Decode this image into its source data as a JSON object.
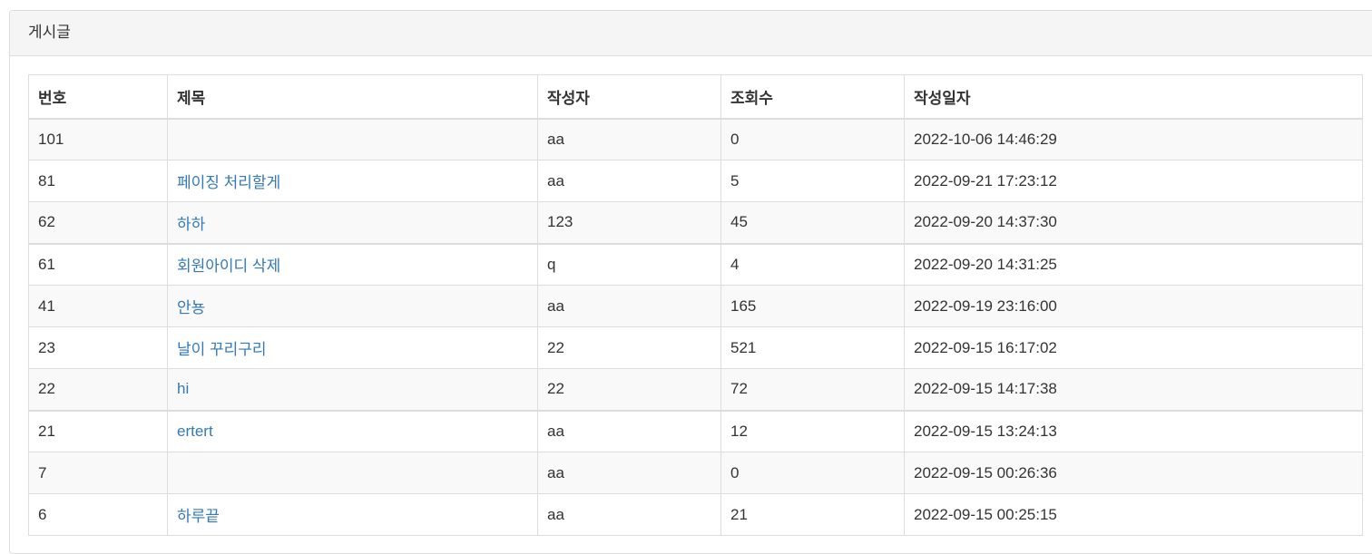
{
  "panel": {
    "heading": "게시글"
  },
  "table": {
    "headers": {
      "no": "번호",
      "title": "제목",
      "author": "작성자",
      "views": "조회수",
      "date": "작성일자"
    },
    "rows": [
      {
        "no": "101",
        "title": "",
        "author": "aa",
        "views": "0",
        "date": "2022-10-06 14:46:29"
      },
      {
        "no": "81",
        "title": "페이징 처리할게",
        "author": "aa",
        "views": "5",
        "date": "2022-09-21 17:23:12"
      },
      {
        "no": "62",
        "title": "하하",
        "author": "123",
        "views": "45",
        "date": "2022-09-20 14:37:30"
      },
      {
        "no": "61",
        "title": "회원아이디 삭제",
        "author": "q",
        "views": "4",
        "date": "2022-09-20 14:31:25"
      },
      {
        "no": "41",
        "title": "안뇽",
        "author": "aa",
        "views": "165",
        "date": "2022-09-19 23:16:00"
      },
      {
        "no": "23",
        "title": "날이 꾸리구리",
        "author": "22",
        "views": "521",
        "date": "2022-09-15 16:17:02"
      },
      {
        "no": "22",
        "title": "hi",
        "author": "22",
        "views": "72",
        "date": "2022-09-15 14:17:38"
      },
      {
        "no": "21",
        "title": "ertert",
        "author": "aa",
        "views": "12",
        "date": "2022-09-15 13:24:13"
      },
      {
        "no": "7",
        "title": "",
        "author": "aa",
        "views": "0",
        "date": "2022-09-15 00:26:36"
      },
      {
        "no": "6",
        "title": "하루끝",
        "author": "aa",
        "views": "21",
        "date": "2022-09-15 00:25:15"
      }
    ]
  },
  "colors": {
    "link": "#337ab7",
    "border": "#dddddd",
    "heading_bg": "#f5f5f5",
    "stripe_bg": "#f9f9f9"
  }
}
